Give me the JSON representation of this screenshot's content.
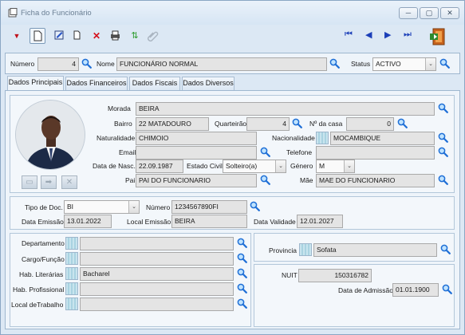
{
  "window": {
    "title": "Ficha do Funcionário",
    "controls": [
      "─",
      "▢",
      "✕"
    ]
  },
  "toolbar": {
    "icons": [
      "dropdown-icon",
      "new-icon",
      "edit-icon",
      "copy-icon",
      "delete-icon",
      "print-icon",
      "refresh-icon",
      "attach-icon"
    ],
    "nav": [
      "⏮",
      "◀",
      "▶",
      "⏭"
    ]
  },
  "header": {
    "numero_label": "Número",
    "numero_value": "4",
    "nome_label": "Nome",
    "nome_value": "FUNCIONÁRIO NORMAL",
    "status_label": "Status",
    "status_value": "ACTIVO"
  },
  "tabs": [
    {
      "label": "Dados Principais",
      "active": true
    },
    {
      "label": "Dados Financeiros",
      "active": false
    },
    {
      "label": "Dados Fiscais",
      "active": false
    },
    {
      "label": "Dados Diversos",
      "active": false
    }
  ],
  "personal": {
    "morada_label": "Morada",
    "morada_value": "BEIRA",
    "bairro_label": "Bairro",
    "bairro_value": "22 MATADOURO",
    "quarteirao_label": "Quarteirão",
    "quarteirao_value": "4",
    "ncasa_label": "Nº da casa",
    "ncasa_value": "0",
    "naturalidade_label": "Naturalidade",
    "naturalidade_value": "CHIMOIO",
    "nacionalidade_label": "Nacionalidade",
    "nacionalidade_value": "MOCAMBIQUE",
    "email_label": "Email",
    "email_value": "",
    "telefone_label": "Telefone",
    "telefone_value": "",
    "nascimento_label": "Data de Nasc.",
    "nascimento_value": "22.09.1987",
    "estado_civil_label": "Estado Civil",
    "estado_civil_value": "Solteiro(a)",
    "genero_label": "Género",
    "genero_value": "M",
    "pai_label": "Pai",
    "pai_value": "PAI DO FUNCIONARIO",
    "mae_label": "Mãe",
    "mae_value": "MAE DO FUNCIONARIO"
  },
  "document": {
    "tipo_label": "Tipo de Doc.",
    "tipo_value": "BI",
    "numero_label": "Número",
    "numero_value": "1234567890FI",
    "emissao_label": "Data Emissão",
    "emissao_value": "13.01.2022",
    "local_label": "Local Emissão",
    "local_value": "BEIRA",
    "validade_label": "Data Validade",
    "validade_value": "12.01.2027"
  },
  "job": {
    "departamento_label": "Departamento",
    "departamento_value": "",
    "cargo_label": "Cargo/Função",
    "cargo_value": "",
    "literarias_label": "Hab. Literárias",
    "literarias_value": "Bacharel",
    "profissional_label": "Hab. Profissional",
    "profissional_value": "",
    "local_label": "Local deTrabalho",
    "local_value": ""
  },
  "fiscal": {
    "provincia_label": "Provincia",
    "provincia_value": "Sofata",
    "nuit_label": "NUIT",
    "nuit_value": "150316782",
    "admissao_label": "Data de Admissão",
    "admissao_value": "01.01.1900"
  },
  "colors": {
    "accent": "#1c3fb8",
    "window_bg": "#dce8f4",
    "field_bg": "#e4e4e4"
  }
}
